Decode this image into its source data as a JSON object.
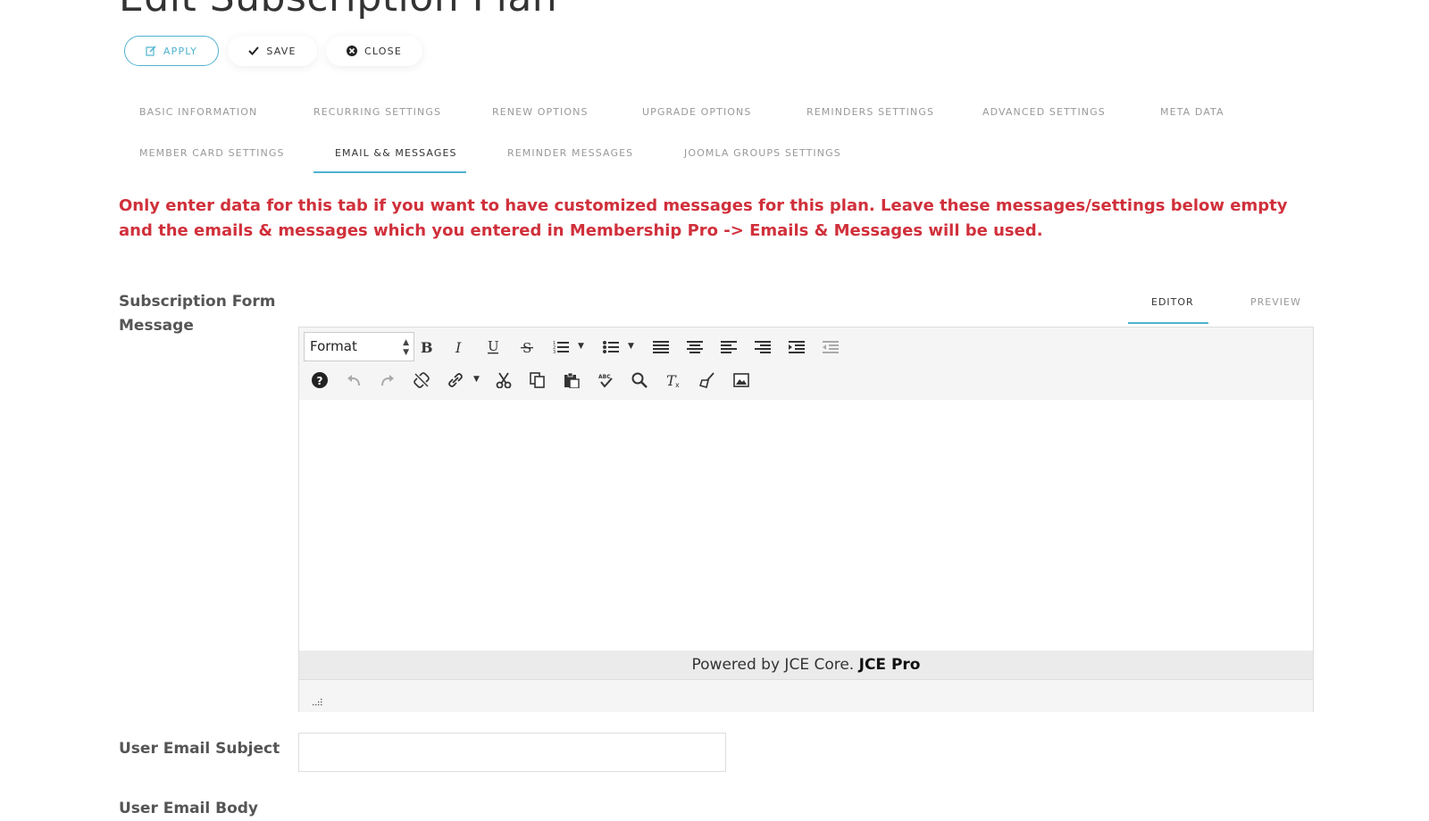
{
  "page": {
    "title": "Edit Subscription Plan"
  },
  "toolbar": {
    "apply": "APPLY",
    "save": "SAVE",
    "close": "CLOSE"
  },
  "tabs": [
    {
      "label": "BASIC INFORMATION",
      "active": false
    },
    {
      "label": "RECURRING SETTINGS",
      "active": false
    },
    {
      "label": "RENEW OPTIONS",
      "active": false
    },
    {
      "label": "UPGRADE OPTIONS",
      "active": false
    },
    {
      "label": "REMINDERS SETTINGS",
      "active": false
    },
    {
      "label": "ADVANCED SETTINGS",
      "active": false
    },
    {
      "label": "META DATA",
      "active": false
    },
    {
      "label": "MEMBER CARD SETTINGS",
      "active": false
    },
    {
      "label": "EMAIL && MESSAGES",
      "active": true
    },
    {
      "label": "REMINDER MESSAGES",
      "active": false
    },
    {
      "label": "JOOMLA GROUPS SETTINGS",
      "active": false
    }
  ],
  "notice": "Only enter data for this tab if you want to have customized messages for this plan. Leave these messages/settings below empty and the emails & messages which you entered in Membership Pro -> Emails & Messages will be used.",
  "fields": {
    "subscription_form_message": {
      "label_line1": "Subscription Form",
      "label_line2": "Message"
    },
    "user_email_subject": {
      "label": "User Email Subject",
      "value": ""
    },
    "user_email_body": {
      "label": "User Email Body"
    }
  },
  "editor": {
    "tabs": {
      "editor": "EDITOR",
      "preview": "PREVIEW"
    },
    "format_select": "Format",
    "footer_prefix": "Powered by JCE Core.",
    "footer_brand": "JCE Pro",
    "content": ""
  },
  "colors": {
    "accent": "#4fb3cf",
    "notice": "#d0303b"
  }
}
